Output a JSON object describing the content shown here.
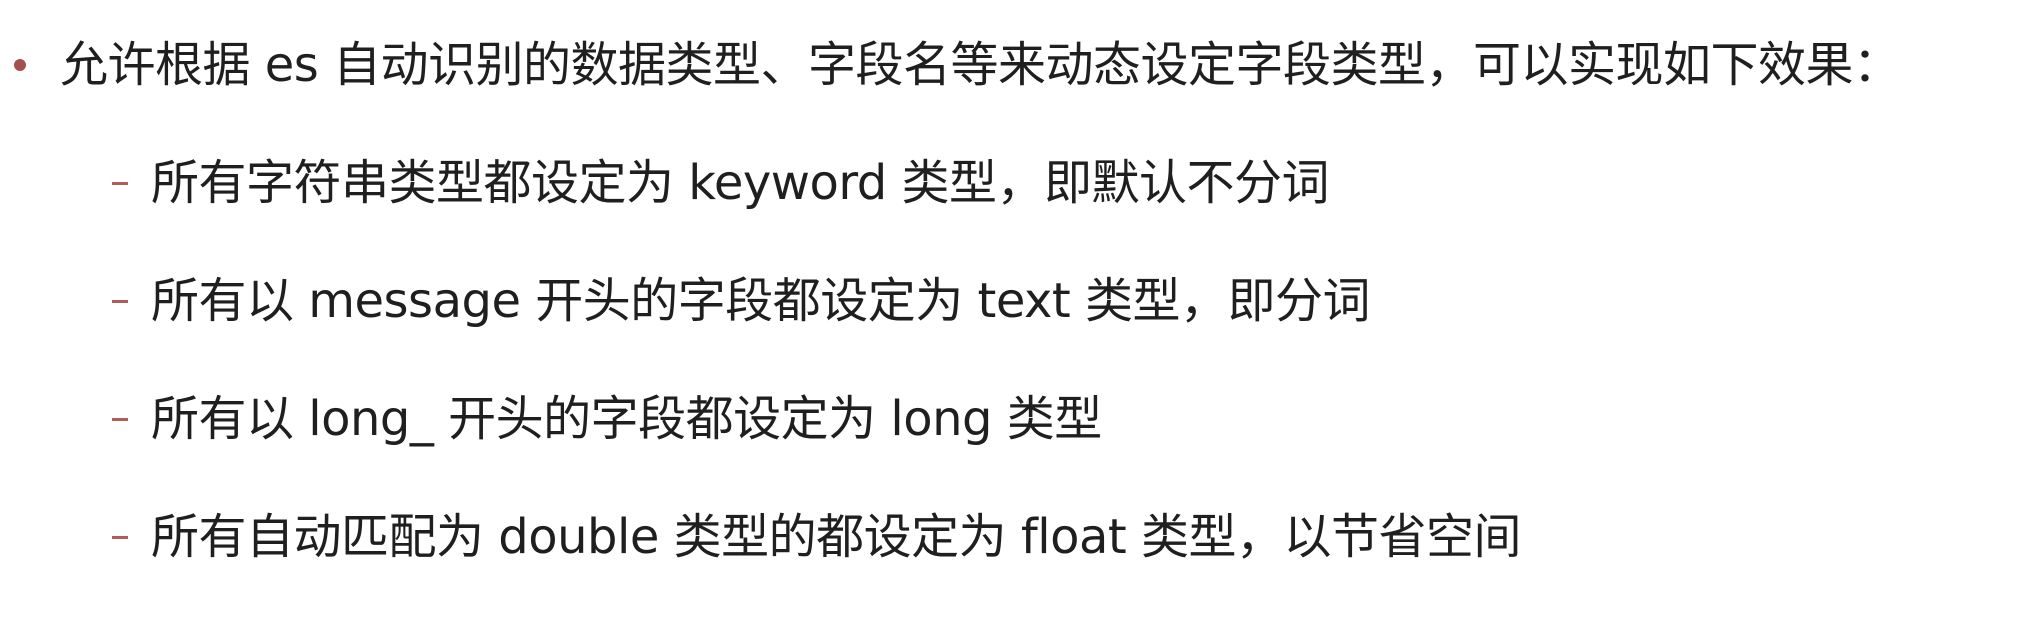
{
  "main_bullet": {
    "text": "允许根据 es 自动识别的数据类型、字段名等来动态设定字段类型，可以实现如下效果："
  },
  "sub_items": [
    {
      "text": "所有字符串类型都设定为 keyword 类型，即默认不分词"
    },
    {
      "text": "所有以 message 开头的字段都设定为 text 类型，即分词"
    },
    {
      "text": "所有以 long_ 开头的字段都设定为 long 类型"
    },
    {
      "text": "所有自动匹配为 double 类型的都设定为 float 类型，以节省空间"
    }
  ],
  "colors": {
    "bullet": "#a4504f",
    "dash": "#b25d5b",
    "text": "#1f1f1f",
    "background": "#ffffff"
  }
}
